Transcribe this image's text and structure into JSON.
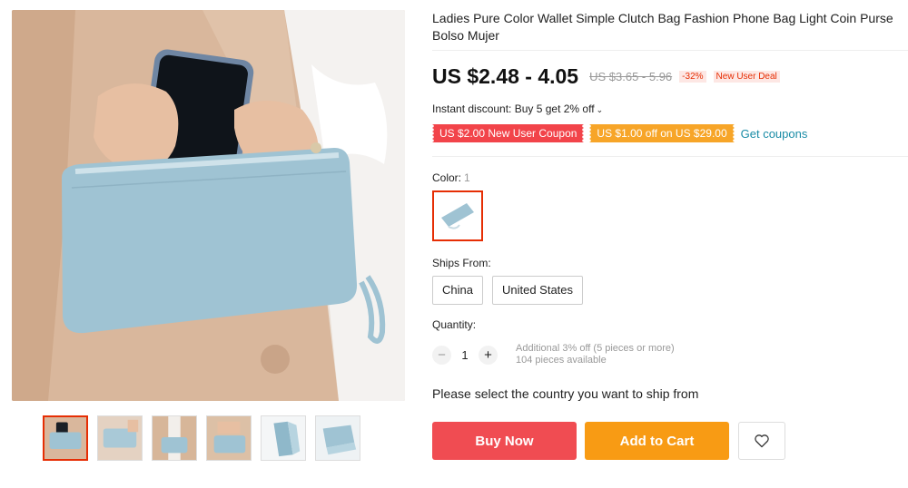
{
  "product": {
    "title": "Ladies Pure Color Wallet Simple Clutch Bag Fashion Phone Bag Light Coin Purse Bolso Mujer"
  },
  "price": {
    "current": "US $2.48 - 4.05",
    "original": "US $3.65 - 5.96",
    "discount": "-32%",
    "deal_badge": "New User Deal"
  },
  "instant_discount": "Instant discount: Buy 5 get 2% off",
  "coupons": {
    "new_user": "US $2.00 New User Coupon",
    "threshold": "US $1.00 off on US $29.00",
    "get_link": "Get coupons"
  },
  "color": {
    "label": "Color:",
    "count": "1",
    "swatch_icon": "blue-wallet-thumbnail"
  },
  "ships_from": {
    "label": "Ships From:",
    "options": [
      "China",
      "United States"
    ]
  },
  "quantity": {
    "label": "Quantity:",
    "minus": "−",
    "value": "1",
    "plus": "+",
    "note_line1": "Additional 3% off (5 pieces or more)",
    "note_line2": "104 pieces available"
  },
  "ship_message": "Please select the country you want to ship from",
  "actions": {
    "buy_now": "Buy Now",
    "add_to_cart": "Add to Cart",
    "wishlist_icon": "heart-icon"
  },
  "thumbnails": [
    "thumb-1",
    "thumb-2",
    "thumb-3",
    "thumb-4",
    "thumb-5",
    "thumb-6"
  ],
  "colors": {
    "accent_red": "#e62e04",
    "buy_now": "#f04c52",
    "add_to_cart": "#f89b14",
    "coupon_red": "#f2444a",
    "coupon_orange": "#f7a528",
    "link_teal": "#1a8ca6",
    "wallet_blue": "#9fc3d3"
  }
}
